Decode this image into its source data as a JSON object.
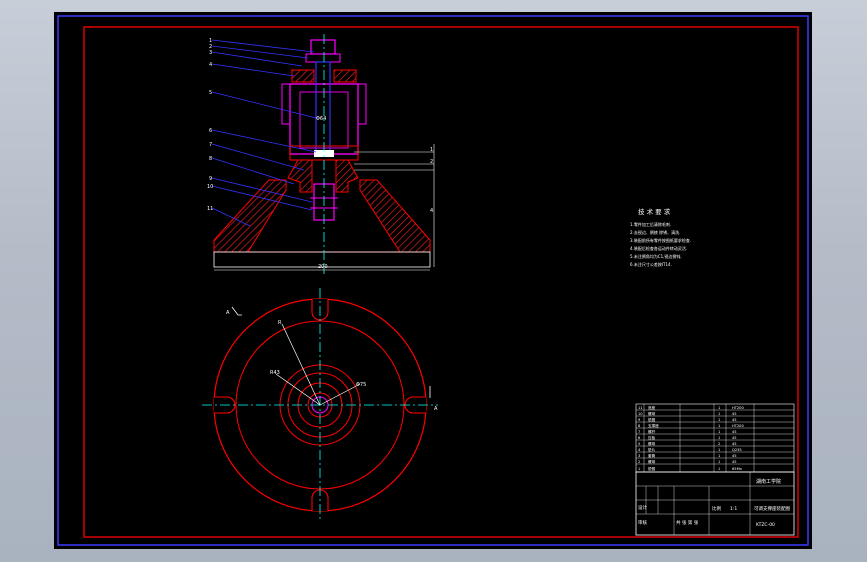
{
  "colors": {
    "background_outer": "#b7bfca",
    "sheet": "#000000",
    "border_outer": "#3a3aff",
    "frame_red": "#ff0000",
    "part_magenta": "#ff00ff",
    "part_blue": "#3333ff",
    "center_cyan": "#00ffff",
    "text_white": "#ffffff",
    "hatch_red": "#ff2020"
  },
  "front_view": {
    "leader_numbers": [
      "1",
      "2",
      "3",
      "4",
      "5",
      "6",
      "7",
      "8",
      "9",
      "10",
      "11"
    ],
    "side_balloons": [
      "1",
      "2",
      "3"
    ],
    "dimension_width": "200",
    "dimension_height": "4",
    "inner_dims": [
      "Φ64",
      "Φ40"
    ]
  },
  "top_view": {
    "label_a_left": "A",
    "label_a_right": "A",
    "radius_labels": [
      "R",
      "R43",
      "Φ75"
    ]
  },
  "notes": {
    "title": "技 术 要 求",
    "lines": [
      "1.零件加工后清除毛刺.",
      "2.去锐边、倒棱 除锈、清洗.",
      "3.装配前所有零件按图纸要求检查.",
      "4.装配后检查各运动件转动灵活.",
      "5.未注倒角均为C1,锐边倒钝.",
      "6.未注尺寸公差按IT14."
    ]
  },
  "parts_list": {
    "rows": [
      [
        "11",
        "底座",
        "1",
        "HT200"
      ],
      [
        "10",
        "螺母",
        "1",
        "45"
      ],
      [
        "9",
        "垫圈",
        "1",
        "45"
      ],
      [
        "8",
        "支撑座",
        "1",
        "HT200"
      ],
      [
        "7",
        "螺杆",
        "1",
        "45"
      ],
      [
        "6",
        "压板",
        "1",
        "45"
      ],
      [
        "5",
        "螺母",
        "2",
        "45"
      ],
      [
        "4",
        "垫片",
        "1",
        "Q235"
      ],
      [
        "3",
        "套筒",
        "1",
        "45"
      ],
      [
        "2",
        "螺母",
        "1",
        "45"
      ],
      [
        "1",
        "垫圈",
        "1",
        "65Mn"
      ]
    ]
  },
  "title_block": {
    "school": "湖南工学院",
    "drawing_name": "可调支撑座装配图",
    "designer_label": "设计",
    "checker_label": "审核",
    "scale_label": "比例",
    "scale_value": "1:1",
    "sheet_label": "共 张 第 张",
    "drawing_no": "KTZC-00"
  }
}
